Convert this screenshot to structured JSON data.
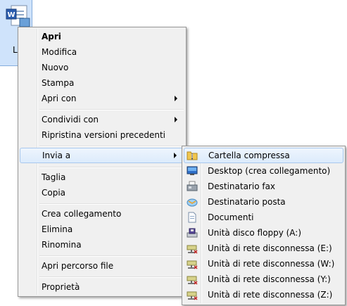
{
  "desktop_file": {
    "label": "L",
    "icon": "word-document-icon"
  },
  "context_menu": {
    "items": [
      {
        "label": "Apri"
      },
      {
        "label": "Modifica"
      },
      {
        "label": "Nuovo"
      },
      {
        "label": "Stampa"
      },
      {
        "label": "Apri con"
      },
      {
        "label": "Condividi con"
      },
      {
        "label": "Ripristina versioni precedenti"
      },
      {
        "label": "Invia a"
      },
      {
        "label": "Taglia"
      },
      {
        "label": "Copia"
      },
      {
        "label": "Crea collegamento"
      },
      {
        "label": "Elimina"
      },
      {
        "label": "Rinomina"
      },
      {
        "label": "Apri percorso file"
      },
      {
        "label": "Proprietà"
      }
    ]
  },
  "send_to_menu": {
    "items": [
      {
        "label": "Cartella compressa",
        "icon": "zip-folder-icon"
      },
      {
        "label": "Desktop (crea collegamento)",
        "icon": "desktop-icon"
      },
      {
        "label": "Destinatario fax",
        "icon": "fax-icon"
      },
      {
        "label": "Destinatario posta",
        "icon": "mail-icon"
      },
      {
        "label": "Documenti",
        "icon": "documents-icon"
      },
      {
        "label": "Unità disco floppy (A:)",
        "icon": "floppy-drive-icon"
      },
      {
        "label": "Unità di rete disconnessa (E:)",
        "icon": "disconnected-network-drive-icon"
      },
      {
        "label": "Unità di rete disconnessa (W:)",
        "icon": "disconnected-network-drive-icon"
      },
      {
        "label": "Unità di rete disconnessa (Y:)",
        "icon": "disconnected-network-drive-icon"
      },
      {
        "label": "Unità di rete disconnessa (Z:)",
        "icon": "disconnected-network-drive-icon"
      }
    ]
  },
  "colors": {
    "menu_bg": "#f0f0f0",
    "highlight": "#dcebfc",
    "highlight_border": "#a8c8ee"
  }
}
